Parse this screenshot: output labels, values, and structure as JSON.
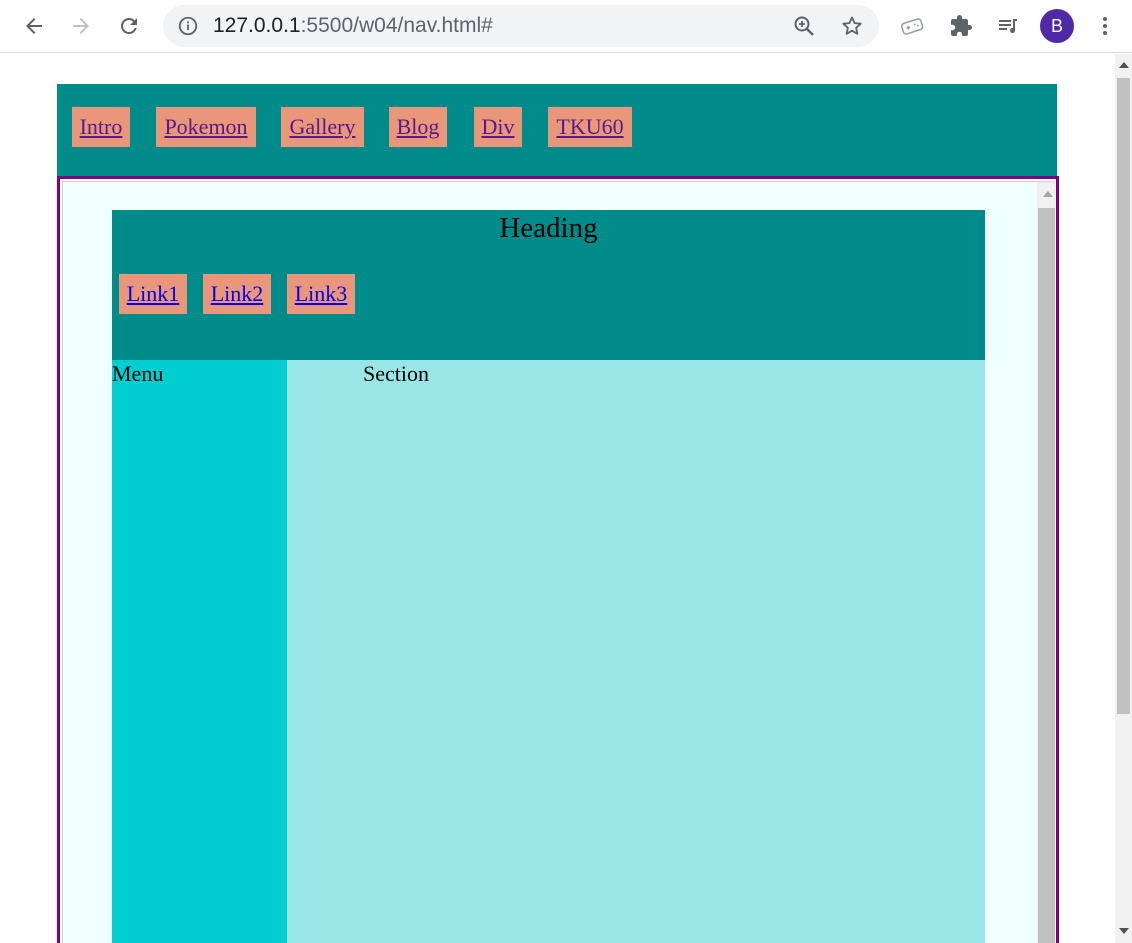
{
  "browser": {
    "url_host": "127.0.0.1",
    "url_rest": ":5500/w04/nav.html#",
    "profile_initial": "B"
  },
  "site_nav": {
    "links": [
      "Intro",
      "Pokemon",
      "Gallery",
      "Blog",
      "Div",
      "TKU60"
    ]
  },
  "embedded": {
    "heading": "Heading",
    "links": [
      "Link1",
      "Link2",
      "Link3"
    ],
    "menu_label": "Menu",
    "section_label": "Section"
  },
  "colors": {
    "nav_bg": "#008b8b",
    "link_bg": "#e9967a",
    "frame_border": "#7f007f",
    "menu_bg": "#00ced1",
    "section_bg": "#99e6e6"
  }
}
